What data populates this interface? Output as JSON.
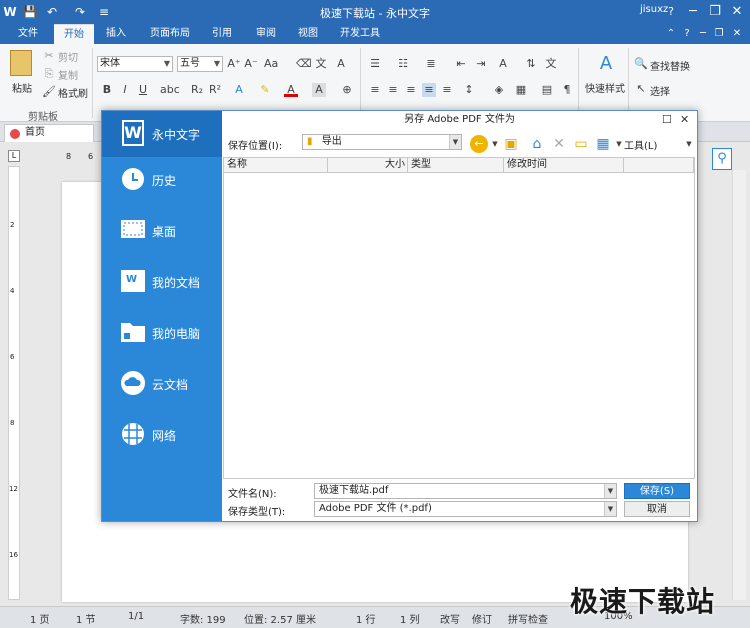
{
  "window": {
    "title": "极速下载站 - 永中文字",
    "user": "jisuxz",
    "controls": [
      "?",
      "─",
      "❐",
      "✕"
    ]
  },
  "quick_access": [
    "W",
    "💾",
    "↶",
    "↷",
    "≡"
  ],
  "tabs": [
    "文件",
    "开始",
    "插入",
    "页面布局",
    "引用",
    "审阅",
    "视图",
    "开发工具"
  ],
  "tab_right": [
    "⌃",
    "?",
    "─",
    "❐",
    "✕"
  ],
  "ribbon": {
    "paste": "粘贴",
    "cut": "剪切",
    "copy": "复制",
    "format_painter": "格式刷",
    "clipboard_group": "剪贴板",
    "font_name": "宋体",
    "font_size": "五号",
    "quick_styles": "快速样式",
    "find_replace": "查找替换",
    "select": "选择"
  },
  "doc_tab": "首页",
  "dialog": {
    "title": "另存 Adobe PDF 文件为",
    "brand": "永中文字",
    "brand_logo": "W",
    "nav": [
      {
        "label": "历史",
        "icon": "clock-icon"
      },
      {
        "label": "桌面",
        "icon": "desktop-icon"
      },
      {
        "label": "我的文档",
        "icon": "document-icon"
      },
      {
        "label": "我的电脑",
        "icon": "computer-icon"
      },
      {
        "label": "云文档",
        "icon": "cloud-icon"
      },
      {
        "label": "网络",
        "icon": "network-icon"
      }
    ],
    "location_label": "保存位置(I):",
    "location_value": "导出",
    "tools_label": "工具(L)",
    "columns": [
      "名称",
      "大小",
      "类型",
      "修改时间"
    ],
    "filename_label": "文件名(N):",
    "filename_value": "极速下载站.pdf",
    "filetype_label": "保存类型(T):",
    "filetype_value": "Adobe PDF 文件 (*.pdf)",
    "save_button": "保存(S)",
    "cancel_button": "取消"
  },
  "ruler": {
    "h": [
      "8",
      "6"
    ],
    "v": [
      "2",
      "4",
      "6",
      "8",
      "10",
      "12",
      "14",
      "16",
      "18"
    ]
  },
  "status": {
    "page": "1 页",
    "section": "1 节",
    "pages": "1/1",
    "words": "字数: 199",
    "position": "位置: 2.57 厘米",
    "line": "1 行",
    "col": "1 列",
    "overwrite": "改写",
    "revise": "修订",
    "spell": "拼写检查",
    "zoom": "100%"
  },
  "watermark": "极速下载站",
  "colors": {
    "title_blue": "#2b6bb6",
    "sidebar_blue": "#2b88d8",
    "brand_blue": "#1e6fbe"
  }
}
